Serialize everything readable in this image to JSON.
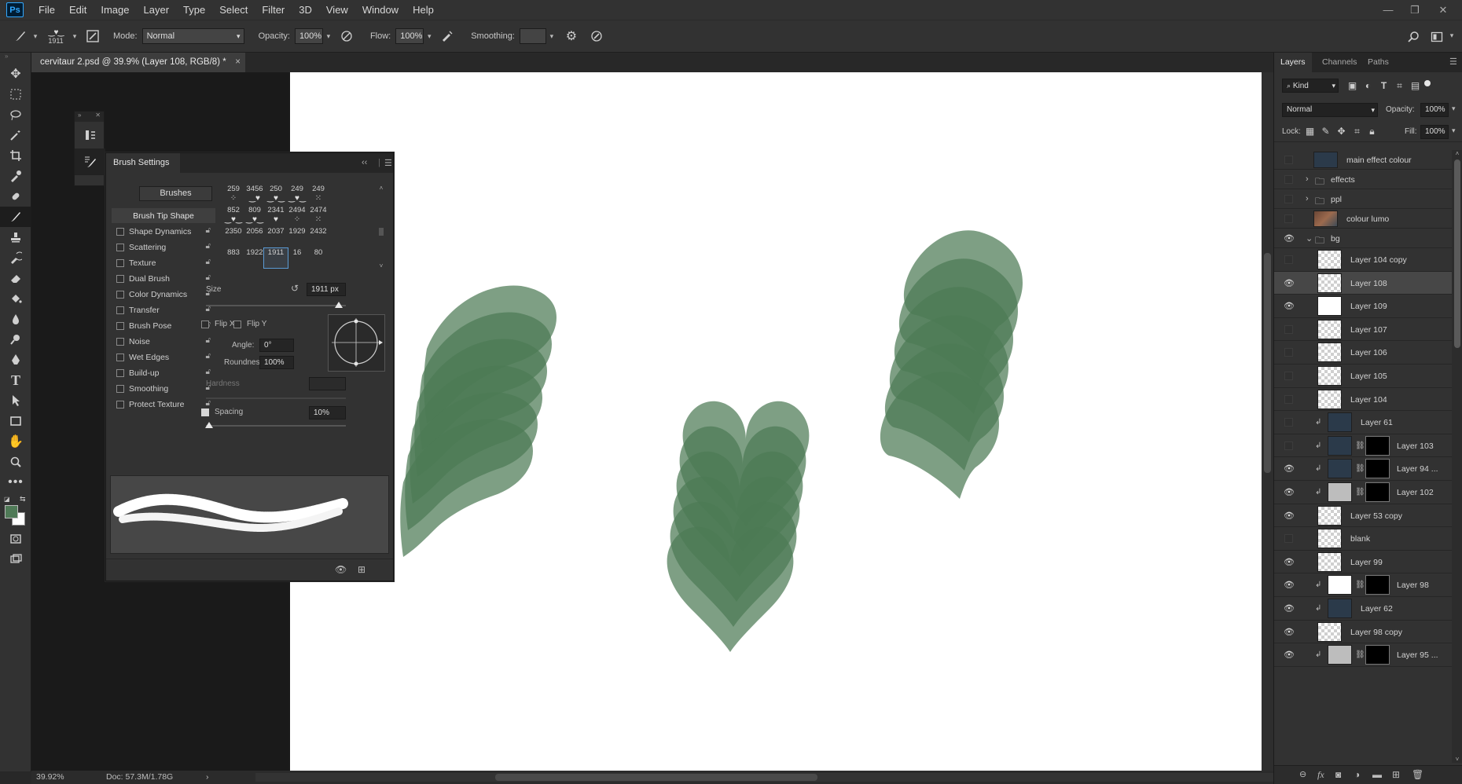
{
  "app": {
    "logo": "Ps"
  },
  "menu": [
    "File",
    "Edit",
    "Image",
    "Layer",
    "Type",
    "Select",
    "Filter",
    "3D",
    "View",
    "Window",
    "Help"
  ],
  "options_bar": {
    "brush_size": "1911",
    "mode_label": "Mode:",
    "mode_value": "Normal",
    "opacity_label": "Opacity:",
    "opacity_value": "100%",
    "flow_label": "Flow:",
    "flow_value": "100%",
    "smoothing_label": "Smoothing:",
    "smoothing_value": ""
  },
  "document": {
    "tab_title": "cervitaur 2.psd @ 39.9% (Layer 108, RGB/8) *",
    "close": "×"
  },
  "status": {
    "zoom": "39.92%",
    "doc": "Doc: 57.3M/1.78G",
    "arrow": "›"
  },
  "brush_settings": {
    "tab": "Brush Settings",
    "brushes_button": "Brushes",
    "head_option": "Brush Tip Shape",
    "options": [
      {
        "label": "Shape Dynamics",
        "checked": false
      },
      {
        "label": "Scattering",
        "checked": false
      },
      {
        "label": "Texture",
        "checked": false
      },
      {
        "label": "Dual Brush",
        "checked": false
      },
      {
        "label": "Color Dynamics",
        "checked": false
      },
      {
        "label": "Transfer",
        "checked": false
      },
      {
        "label": "Brush Pose",
        "checked": false
      },
      {
        "label": "Noise",
        "checked": false
      },
      {
        "label": "Wet Edges",
        "checked": false
      },
      {
        "label": "Build-up",
        "checked": false
      },
      {
        "label": "Smoothing",
        "checked": false
      },
      {
        "label": "Protect Texture",
        "checked": false
      }
    ],
    "tips": [
      [
        "259",
        "3456",
        "250",
        "249",
        "249"
      ],
      [
        "852",
        "809",
        "2341",
        "2494",
        "2474"
      ],
      [
        "2350",
        "2056",
        "2037",
        "1929",
        "2432"
      ],
      [
        "883",
        "1922",
        "1911",
        "16",
        "80"
      ]
    ],
    "selected_tip": "1911",
    "size_label": "Size",
    "size_value": "1911 px",
    "size_fraction": 0.95,
    "flip_x": "Flip X",
    "flip_y": "Flip Y",
    "angle_label": "Angle:",
    "angle_value": "0°",
    "roundness_label": "Roundness:",
    "roundness_value": "100%",
    "hardness_label": "Hardness",
    "spacing_label": "Spacing",
    "spacing_value": "10%",
    "spacing_checked": true,
    "spacing_fraction": 0.02
  },
  "layers_panel": {
    "tabs": [
      "Layers",
      "Channels",
      "Paths"
    ],
    "kind_label": "Kind",
    "blend_mode": "Normal",
    "opacity_label": "Opacity:",
    "opacity_value": "100%",
    "lock_label": "Lock:",
    "fill_label": "Fill:",
    "fill_value": "100%",
    "layers": [
      {
        "name": "main effect colour",
        "visible": false,
        "type": "fill"
      },
      {
        "name": "effects",
        "visible": false,
        "type": "group-closed"
      },
      {
        "name": "ppl",
        "visible": false,
        "type": "group-closed"
      },
      {
        "name": "colour lumo",
        "visible": false,
        "type": "image"
      },
      {
        "name": "bg",
        "visible": true,
        "type": "group-open"
      },
      {
        "name": "Layer 104 copy",
        "visible": false,
        "type": "pixel"
      },
      {
        "name": "Layer 108",
        "visible": true,
        "type": "pixel",
        "selected": true
      },
      {
        "name": "Layer 109",
        "visible": true,
        "type": "white"
      },
      {
        "name": "Layer 107",
        "visible": false,
        "type": "pixel"
      },
      {
        "name": "Layer 106",
        "visible": false,
        "type": "pixel"
      },
      {
        "name": "Layer 105",
        "visible": false,
        "type": "pixel"
      },
      {
        "name": "Layer 104",
        "visible": false,
        "type": "pixel"
      },
      {
        "name": "Layer 61",
        "visible": false,
        "type": "fill",
        "clip": true
      },
      {
        "name": "Layer 103",
        "visible": false,
        "type": "fill",
        "clip": true,
        "mask": true
      },
      {
        "name": "Layer 94 ...",
        "visible": true,
        "type": "fill",
        "clip": true,
        "mask": true
      },
      {
        "name": "Layer 102",
        "visible": true,
        "type": "gray",
        "clip": true,
        "mask": true
      },
      {
        "name": "Layer 53 copy",
        "visible": true,
        "type": "pixel"
      },
      {
        "name": "blank",
        "visible": false,
        "type": "pixel"
      },
      {
        "name": "Layer 99",
        "visible": true,
        "type": "pixel"
      },
      {
        "name": "Layer 98",
        "visible": true,
        "type": "white",
        "clip": true,
        "mask": true
      },
      {
        "name": "Layer 62",
        "visible": true,
        "type": "fill",
        "clip": true
      },
      {
        "name": "Layer 98 copy",
        "visible": true,
        "type": "pixel"
      },
      {
        "name": "Layer 95 ...",
        "visible": true,
        "type": "gray",
        "clip": true,
        "mask": true
      }
    ]
  },
  "colors": {
    "foreground": "#4f7a57",
    "background": "#ffffff",
    "leaf": "#4c7a55",
    "fill_layer": "#2b3a4a",
    "accent": "#31a8ff"
  }
}
